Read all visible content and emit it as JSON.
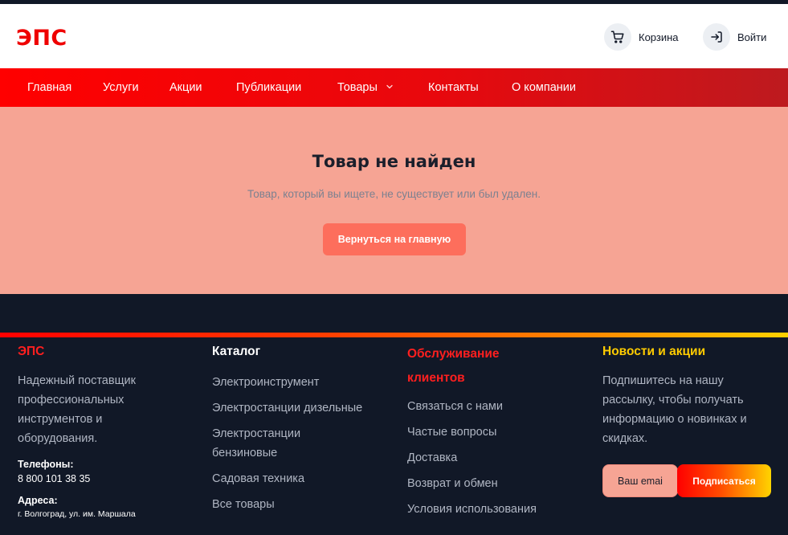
{
  "header": {
    "logo": "ЭПС",
    "cart_label": "Корзина",
    "login_label": "Войти"
  },
  "nav": {
    "items": [
      {
        "label": "Главная"
      },
      {
        "label": "Услуги"
      },
      {
        "label": "Акции"
      },
      {
        "label": "Публикации"
      },
      {
        "label": "Товары",
        "dropdown": true
      },
      {
        "label": "Контакты"
      },
      {
        "label": "О компании"
      }
    ]
  },
  "main": {
    "title": "Товар не найден",
    "message": "Товар, который вы ищете, не существует или был удален.",
    "button_label": "Вернуться на главную"
  },
  "footer": {
    "brand": {
      "title": "ЭПС",
      "description_lines": [
        "Надежный поставщик",
        "профессиональных",
        "инструментов и",
        "оборудования."
      ],
      "phones_label": "Телефоны:",
      "phone": "8 800 101 38 35",
      "address_label": "Адреса:",
      "address": "г. Волгоград, ул. им. Маршала"
    },
    "catalog": {
      "title": "Каталог",
      "links": [
        "Электроинструмент",
        "Электростанции дизельные",
        "Электростанции бензиновые",
        "Садовая техника",
        "Все товары"
      ]
    },
    "service": {
      "title_lines": [
        "Обслуживание",
        "клиентов"
      ],
      "links": [
        "Связаться с нами",
        "Частые вопросы",
        "Доставка",
        "Возврат и обмен",
        "Условия использования"
      ]
    },
    "news": {
      "title": "Новости и акции",
      "text_lines": [
        "Подпишитесь на нашу",
        "рассылку, чтобы получать",
        "информацию о новинках и",
        "скидках."
      ],
      "email_placeholder": "Ваш emai",
      "subscribe_label": "Подписаться"
    }
  },
  "colors": {
    "brand_red": "#ef0000",
    "hero_bg": "#f6a494",
    "button_bg": "#fd6e5c",
    "footer_bg": "#111827",
    "news_title": "#ffcc00",
    "service_title": "#ff1f1f"
  },
  "icons": {
    "cart": "cart-icon",
    "login": "login-arrow-icon",
    "dropdown": "chevron-down-icon"
  }
}
